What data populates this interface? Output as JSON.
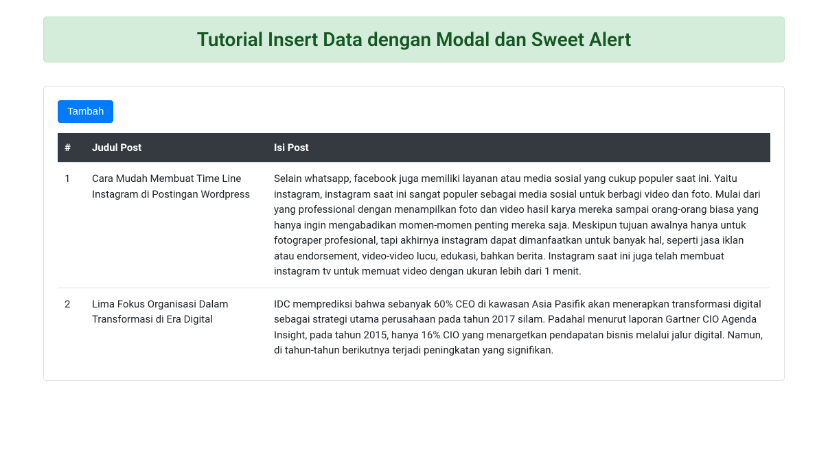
{
  "banner": {
    "title": "Tutorial Insert Data dengan Modal dan Sweet Alert"
  },
  "toolbar": {
    "add_label": "Tambah"
  },
  "table": {
    "headers": {
      "num": "#",
      "title": "Judul Post",
      "content": "Isi Post"
    },
    "rows": [
      {
        "num": "1",
        "title": "Cara Mudah Membuat Time Line Instagram di Postingan Wordpress",
        "content": "Selain whatsapp, facebook juga memiliki layanan atau media sosial yang cukup populer saat ini. Yaitu instagram, instagram saat ini sangat populer sebagai media sosial untuk berbagi video dan foto. Mulai dari yang professional dengan menampilkan foto dan video hasil karya mereka sampai orang-orang biasa yang hanya ingin mengabadikan momen-momen penting mereka saja. Meskipun tujuan awalnya hanya untuk fotograper profesional, tapi akhirnya instagram dapat dimanfaatkan untuk banyak hal, seperti jasa iklan atau endorsement, video-video lucu, edukasi, bahkan berita. Instagram saat ini juga telah membuat instagram tv untuk memuat video dengan ukuran lebih dari 1 menit."
      },
      {
        "num": "2",
        "title": "Lima Fokus Organisasi Dalam Transformasi di Era Digital",
        "content": "IDC memprediksi bahwa sebanyak 60% CEO di kawasan Asia Pasifik akan menerapkan transformasi digital sebagai strategi utama perusahaan pada tahun 2017 silam. Padahal menurut laporan Gartner CIO Agenda Insight, pada tahun 2015, hanya 16% CIO yang menargetkan pendapatan bisnis melalui jalur digital. Namun, di tahun-tahun berikutnya terjadi peningkatan yang signifikan."
      }
    ]
  }
}
